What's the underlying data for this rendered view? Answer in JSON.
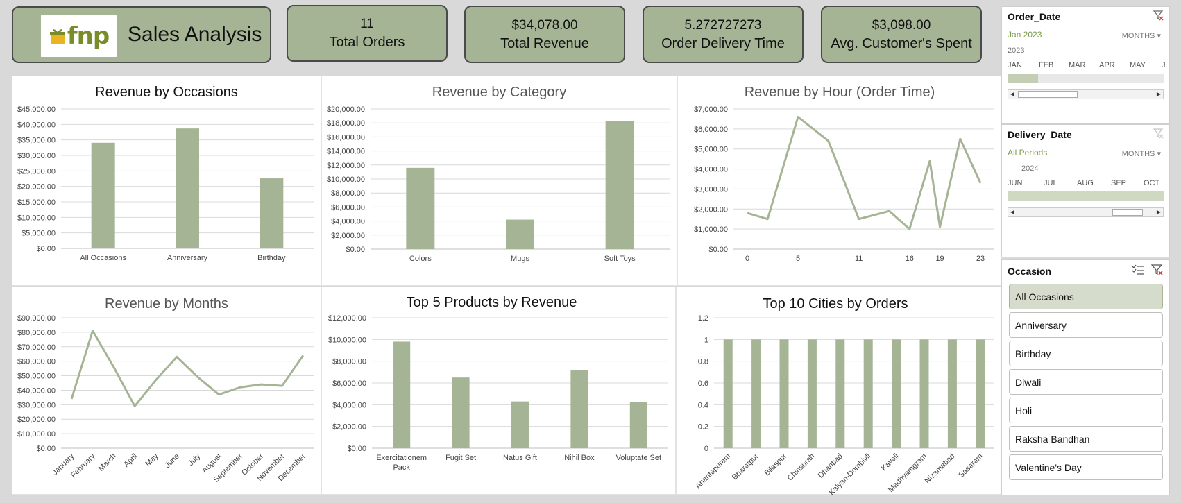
{
  "header": {
    "logo_text": "fnp",
    "title": "Sales Analysis"
  },
  "kpis": [
    {
      "value": "11",
      "label": "Total Orders"
    },
    {
      "value": "$34,078.00",
      "label": "Total Revenue"
    },
    {
      "value": "5.272727273",
      "label": "Order Delivery Time"
    },
    {
      "value": "$3,098.00",
      "label": "Avg. Customer's Spent"
    }
  ],
  "colors": {
    "accent": "#a4b494",
    "line": "#a4b494",
    "bar": "#a4b494"
  },
  "chart_data": [
    {
      "type": "bar",
      "title": "Revenue by Occasions",
      "categories": [
        "All Occasions",
        "Anniversary",
        "Birthday"
      ],
      "values": [
        34078,
        38700,
        22600
      ],
      "ylim": [
        0,
        45000
      ],
      "yticks": [
        "$0.00",
        "$5,000.00",
        "$10,000.00",
        "$15,000.00",
        "$20,000.00",
        "$25,000.00",
        "$30,000.00",
        "$35,000.00",
        "$40,000.00",
        "$45,000.00"
      ],
      "grid": true
    },
    {
      "type": "bar",
      "title": "Revenue by Category",
      "categories": [
        "Colors",
        "Mugs",
        "Soft Toys"
      ],
      "values": [
        11600,
        4200,
        18300
      ],
      "ylim": [
        0,
        20000
      ],
      "yticks": [
        "$0.00",
        "$2,000.00",
        "$4,000.00",
        "$6,000.00",
        "$8,000.00",
        "$10,000.00",
        "$12,000.00",
        "$14,000.00",
        "$16,000.00",
        "$18,000.00",
        "$20,000.00"
      ],
      "grid": true
    },
    {
      "type": "line",
      "title": "Revenue by Hour (Order Time)",
      "x": [
        0,
        2,
        5,
        8,
        11,
        14,
        16,
        18,
        19,
        21,
        23
      ],
      "values": [
        1800,
        1500,
        6600,
        5400,
        1500,
        1900,
        1000,
        4400,
        1100,
        5500,
        3300
      ],
      "xticks": [
        "0",
        "5",
        "11",
        "16",
        "19",
        "23"
      ],
      "ylim": [
        0,
        7000
      ],
      "yticks": [
        "$0.00",
        "$1,000.00",
        "$2,000.00",
        "$3,000.00",
        "$4,000.00",
        "$5,000.00",
        "$6,000.00",
        "$7,000.00"
      ],
      "grid": true
    },
    {
      "type": "line",
      "title": "Revenue by Months",
      "categories": [
        "January",
        "February",
        "March",
        "April",
        "May",
        "June",
        "July",
        "August",
        "September",
        "October",
        "November",
        "December"
      ],
      "values": [
        34000,
        81000,
        56000,
        29000,
        47000,
        63000,
        49000,
        37000,
        42000,
        44000,
        43000,
        64000
      ],
      "ylim": [
        0,
        90000
      ],
      "yticks": [
        "$0.00",
        "$10,000.00",
        "$20,000.00",
        "$30,000.00",
        "$40,000.00",
        "$50,000.00",
        "$60,000.00",
        "$70,000.00",
        "$80,000.00",
        "$90,000.00"
      ],
      "grid": true
    },
    {
      "type": "bar",
      "title": "Top 5 Products by Revenue",
      "categories": [
        "Exercitationem Pack",
        "Fugit Set",
        "Natus Gift",
        "Nihil Box",
        "Voluptate Set"
      ],
      "values": [
        9800,
        6500,
        4300,
        7200,
        4250
      ],
      "ylim": [
        0,
        12000
      ],
      "yticks": [
        "$0.00",
        "$2,000.00",
        "$4,000.00",
        "$6,000.00",
        "$8,000.00",
        "$10,000.00",
        "$12,000.00"
      ],
      "grid": true
    },
    {
      "type": "bar",
      "title": "Top 10 Cities by Orders",
      "categories": [
        "Anantapuram",
        "Bharatpur",
        "Bilaspur",
        "Chinsurah",
        "Dhanbad",
        "Kalyan-Dombivli",
        "Kavali",
        "Madhyamgram",
        "Nizamabad",
        "Sasaram"
      ],
      "values": [
        1,
        1,
        1,
        1,
        1,
        1,
        1,
        1,
        1,
        1
      ],
      "ylim": [
        0,
        1.2
      ],
      "yticks": [
        "0",
        "0.2",
        "0.4",
        "0.6",
        "0.8",
        "1",
        "1.2"
      ],
      "grid": true
    }
  ],
  "slicers": {
    "order_date": {
      "title": "Order_Date",
      "selection": "Jan 2023",
      "level": "MONTHS",
      "year": "2023",
      "months": [
        "JAN",
        "FEB",
        "MAR",
        "APR",
        "MAY",
        "J"
      ]
    },
    "delivery_date": {
      "title": "Delivery_Date",
      "selection": "All Periods",
      "level": "MONTHS",
      "year": "2024",
      "months": [
        "JUN",
        "JUL",
        "AUG",
        "SEP",
        "OCT"
      ]
    },
    "occasion": {
      "title": "Occasion",
      "items": [
        "All Occasions",
        "Anniversary",
        "Birthday",
        "Diwali",
        "Holi",
        "Raksha Bandhan",
        "Valentine's Day"
      ],
      "selected": "All Occasions"
    }
  }
}
